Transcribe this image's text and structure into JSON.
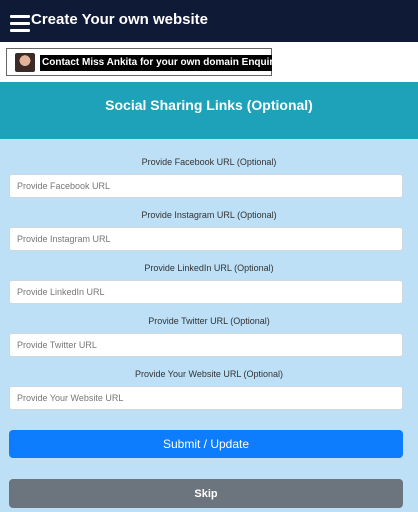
{
  "header": {
    "title": "Create Your own website",
    "menu_icon": "hamburger-menu-icon"
  },
  "banner": {
    "text": "Contact Miss Ankita for your own domain Enquiry"
  },
  "section": {
    "title": "Social Sharing Links (Optional)"
  },
  "fields": [
    {
      "label": "Provide Facebook URL (Optional)",
      "placeholder": "Provide Facebook URL",
      "value": ""
    },
    {
      "label": "Provide Instagram URL (Optional)",
      "placeholder": "Provide Instagram URL",
      "value": ""
    },
    {
      "label": "Provide LinkedIn URL (Optional)",
      "placeholder": "Provide LinkedIn URL",
      "value": ""
    },
    {
      "label": "Provide Twitter URL (Optional)",
      "placeholder": "Provide Twitter URL",
      "value": ""
    },
    {
      "label": "Provide Your Website URL (Optional)",
      "placeholder": "Provide Your Website URL",
      "value": ""
    }
  ],
  "buttons": {
    "submit": "Submit / Update",
    "skip": "Skip"
  },
  "colors": {
    "topbar": "#0f1a36",
    "section_header": "#1ea2b9",
    "form_bg": "#bde0f7",
    "submit_button": "#0d7dfd",
    "skip_button": "#6c757d"
  }
}
